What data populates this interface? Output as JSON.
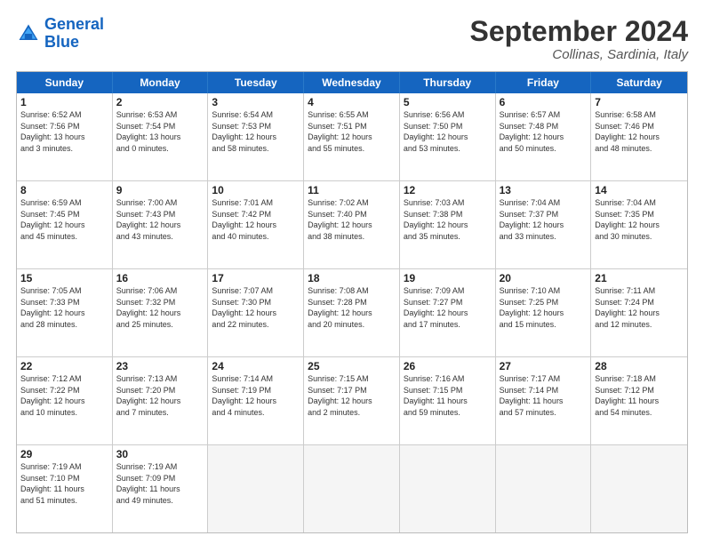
{
  "logo": {
    "text_general": "General",
    "text_blue": "Blue"
  },
  "header": {
    "month": "September 2024",
    "location": "Collinas, Sardinia, Italy"
  },
  "weekdays": [
    "Sunday",
    "Monday",
    "Tuesday",
    "Wednesday",
    "Thursday",
    "Friday",
    "Saturday"
  ],
  "rows": [
    [
      {
        "day": "1",
        "info": "Sunrise: 6:52 AM\nSunset: 7:56 PM\nDaylight: 13 hours\nand 3 minutes."
      },
      {
        "day": "2",
        "info": "Sunrise: 6:53 AM\nSunset: 7:54 PM\nDaylight: 13 hours\nand 0 minutes."
      },
      {
        "day": "3",
        "info": "Sunrise: 6:54 AM\nSunset: 7:53 PM\nDaylight: 12 hours\nand 58 minutes."
      },
      {
        "day": "4",
        "info": "Sunrise: 6:55 AM\nSunset: 7:51 PM\nDaylight: 12 hours\nand 55 minutes."
      },
      {
        "day": "5",
        "info": "Sunrise: 6:56 AM\nSunset: 7:50 PM\nDaylight: 12 hours\nand 53 minutes."
      },
      {
        "day": "6",
        "info": "Sunrise: 6:57 AM\nSunset: 7:48 PM\nDaylight: 12 hours\nand 50 minutes."
      },
      {
        "day": "7",
        "info": "Sunrise: 6:58 AM\nSunset: 7:46 PM\nDaylight: 12 hours\nand 48 minutes."
      }
    ],
    [
      {
        "day": "8",
        "info": "Sunrise: 6:59 AM\nSunset: 7:45 PM\nDaylight: 12 hours\nand 45 minutes."
      },
      {
        "day": "9",
        "info": "Sunrise: 7:00 AM\nSunset: 7:43 PM\nDaylight: 12 hours\nand 43 minutes."
      },
      {
        "day": "10",
        "info": "Sunrise: 7:01 AM\nSunset: 7:42 PM\nDaylight: 12 hours\nand 40 minutes."
      },
      {
        "day": "11",
        "info": "Sunrise: 7:02 AM\nSunset: 7:40 PM\nDaylight: 12 hours\nand 38 minutes."
      },
      {
        "day": "12",
        "info": "Sunrise: 7:03 AM\nSunset: 7:38 PM\nDaylight: 12 hours\nand 35 minutes."
      },
      {
        "day": "13",
        "info": "Sunrise: 7:04 AM\nSunset: 7:37 PM\nDaylight: 12 hours\nand 33 minutes."
      },
      {
        "day": "14",
        "info": "Sunrise: 7:04 AM\nSunset: 7:35 PM\nDaylight: 12 hours\nand 30 minutes."
      }
    ],
    [
      {
        "day": "15",
        "info": "Sunrise: 7:05 AM\nSunset: 7:33 PM\nDaylight: 12 hours\nand 28 minutes."
      },
      {
        "day": "16",
        "info": "Sunrise: 7:06 AM\nSunset: 7:32 PM\nDaylight: 12 hours\nand 25 minutes."
      },
      {
        "day": "17",
        "info": "Sunrise: 7:07 AM\nSunset: 7:30 PM\nDaylight: 12 hours\nand 22 minutes."
      },
      {
        "day": "18",
        "info": "Sunrise: 7:08 AM\nSunset: 7:28 PM\nDaylight: 12 hours\nand 20 minutes."
      },
      {
        "day": "19",
        "info": "Sunrise: 7:09 AM\nSunset: 7:27 PM\nDaylight: 12 hours\nand 17 minutes."
      },
      {
        "day": "20",
        "info": "Sunrise: 7:10 AM\nSunset: 7:25 PM\nDaylight: 12 hours\nand 15 minutes."
      },
      {
        "day": "21",
        "info": "Sunrise: 7:11 AM\nSunset: 7:24 PM\nDaylight: 12 hours\nand 12 minutes."
      }
    ],
    [
      {
        "day": "22",
        "info": "Sunrise: 7:12 AM\nSunset: 7:22 PM\nDaylight: 12 hours\nand 10 minutes."
      },
      {
        "day": "23",
        "info": "Sunrise: 7:13 AM\nSunset: 7:20 PM\nDaylight: 12 hours\nand 7 minutes."
      },
      {
        "day": "24",
        "info": "Sunrise: 7:14 AM\nSunset: 7:19 PM\nDaylight: 12 hours\nand 4 minutes."
      },
      {
        "day": "25",
        "info": "Sunrise: 7:15 AM\nSunset: 7:17 PM\nDaylight: 12 hours\nand 2 minutes."
      },
      {
        "day": "26",
        "info": "Sunrise: 7:16 AM\nSunset: 7:15 PM\nDaylight: 11 hours\nand 59 minutes."
      },
      {
        "day": "27",
        "info": "Sunrise: 7:17 AM\nSunset: 7:14 PM\nDaylight: 11 hours\nand 57 minutes."
      },
      {
        "day": "28",
        "info": "Sunrise: 7:18 AM\nSunset: 7:12 PM\nDaylight: 11 hours\nand 54 minutes."
      }
    ],
    [
      {
        "day": "29",
        "info": "Sunrise: 7:19 AM\nSunset: 7:10 PM\nDaylight: 11 hours\nand 51 minutes."
      },
      {
        "day": "30",
        "info": "Sunrise: 7:19 AM\nSunset: 7:09 PM\nDaylight: 11 hours\nand 49 minutes."
      },
      {
        "day": "",
        "info": ""
      },
      {
        "day": "",
        "info": ""
      },
      {
        "day": "",
        "info": ""
      },
      {
        "day": "",
        "info": ""
      },
      {
        "day": "",
        "info": ""
      }
    ]
  ]
}
